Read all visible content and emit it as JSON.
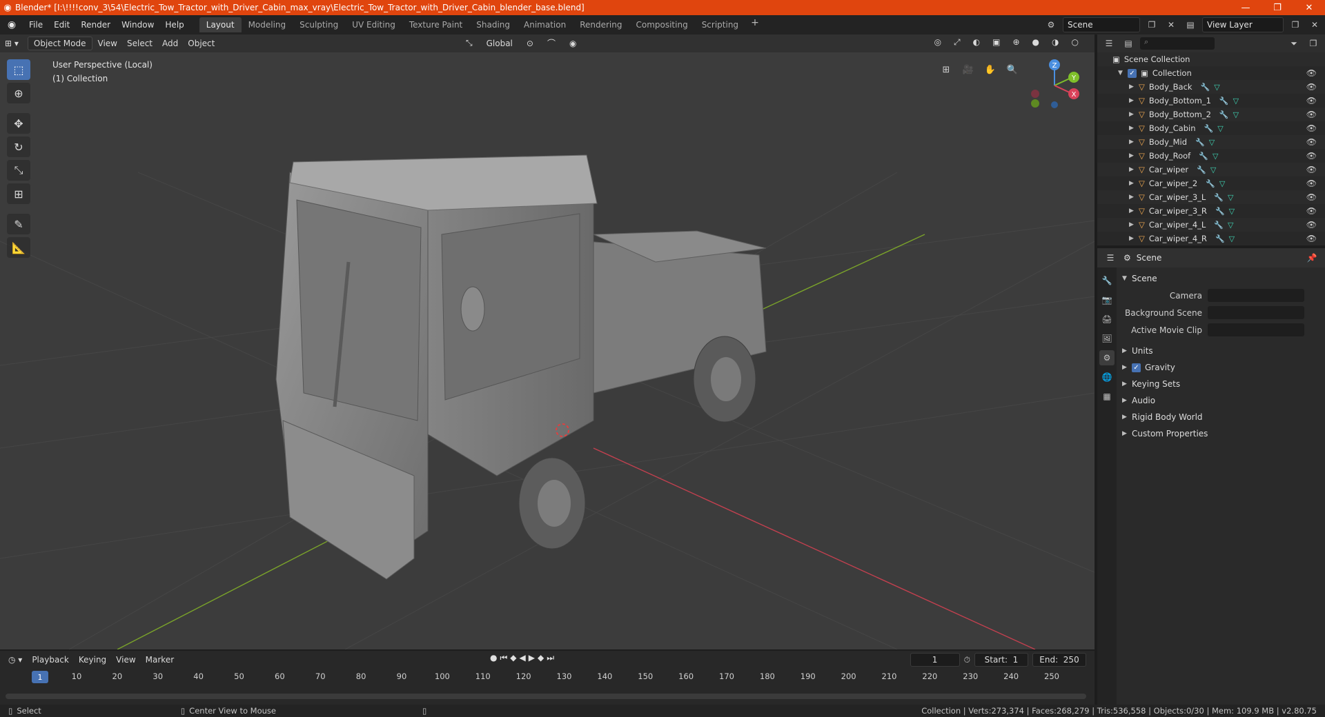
{
  "window": {
    "title": "Blender* [I:\\!!!!conv_3\\54\\Electric_Tow_Tractor_with_Driver_Cabin_max_vray\\Electric_Tow_Tractor_with_Driver_Cabin_blender_base.blend]",
    "minimize": "—",
    "maximize": "❐",
    "close": "✕"
  },
  "menubar": {
    "menus": [
      "File",
      "Edit",
      "Render",
      "Window",
      "Help"
    ],
    "workspaces": [
      "Layout",
      "Modeling",
      "Sculpting",
      "UV Editing",
      "Texture Paint",
      "Shading",
      "Animation",
      "Rendering",
      "Compositing",
      "Scripting"
    ],
    "active_workspace": "Layout",
    "scene": "Scene",
    "view_layer": "View Layer"
  },
  "viewport": {
    "mode": "Object Mode",
    "menus": [
      "View",
      "Select",
      "Add",
      "Object"
    ],
    "transform_orientation": "Global",
    "info_line1": "User Perspective (Local)",
    "info_line2": "(1) Collection",
    "gizmo_axes": {
      "x": "X",
      "y": "Y",
      "z": "Z"
    }
  },
  "outliner": {
    "root": "Scene Collection",
    "collection": "Collection",
    "objects": [
      "Body_Back",
      "Body_Bottom_1",
      "Body_Bottom_2",
      "Body_Cabin",
      "Body_Mid",
      "Body_Roof",
      "Car_wiper",
      "Car_wiper_2",
      "Car_wiper_3_L",
      "Car_wiper_3_R",
      "Car_wiper_4_L",
      "Car_wiper_4_R"
    ]
  },
  "properties": {
    "context": "Scene",
    "section": "Scene",
    "fields": [
      {
        "label": "Camera",
        "value": ""
      },
      {
        "label": "Background Scene",
        "value": ""
      },
      {
        "label": "Active Movie Clip",
        "value": ""
      }
    ],
    "subpanels": [
      "Units",
      "Gravity",
      "Keying Sets",
      "Audio",
      "Rigid Body World",
      "Custom Properties"
    ]
  },
  "timeline": {
    "menus": [
      "Playback",
      "Keying",
      "View",
      "Marker"
    ],
    "current_frame": "1",
    "start_label": "Start:",
    "start": "1",
    "end_label": "End:",
    "end": "250",
    "ticks": [
      "10",
      "20",
      "30",
      "40",
      "50",
      "60",
      "70",
      "80",
      "90",
      "100",
      "110",
      "120",
      "130",
      "140",
      "150",
      "160",
      "170",
      "180",
      "190",
      "200",
      "210",
      "220",
      "230",
      "240",
      "250"
    ],
    "ruler_current": "1"
  },
  "statusbar": {
    "select": "Select",
    "center_view": "Center View to Mouse",
    "stats": "Collection | Verts:273,374 | Faces:268,279 | Tris:536,558 | Objects:0/30 | Mem: 109.9 MB | v2.80.75"
  },
  "colors": {
    "accent": "#4772b3",
    "titlebar": "#e0450e",
    "mesh_icon": "#f0a850",
    "x_axis": "#d9425a",
    "y_axis": "#7fbf2a",
    "z_axis": "#4a8fe0"
  }
}
